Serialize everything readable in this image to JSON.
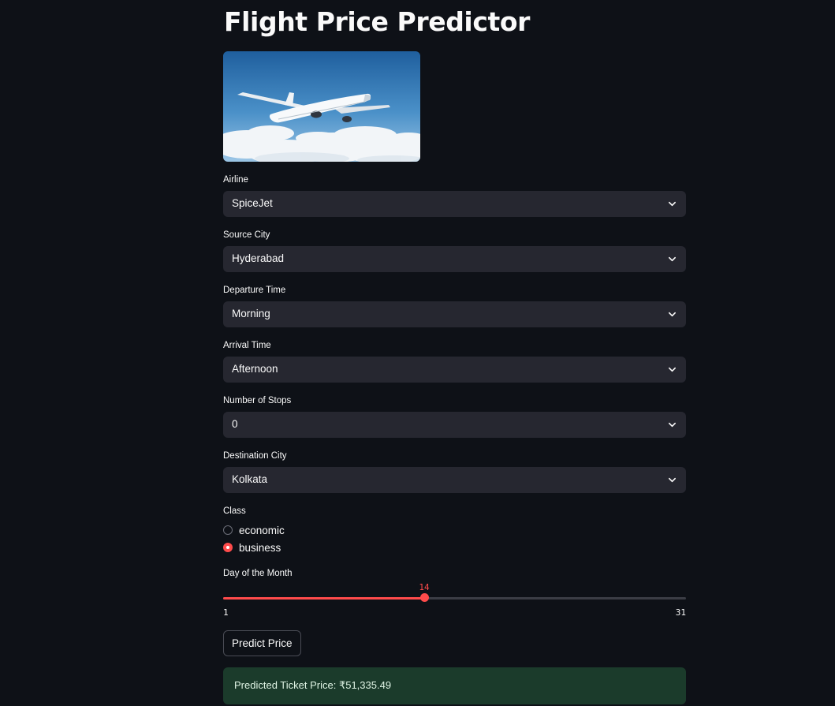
{
  "page": {
    "title": "Flight Price Predictor"
  },
  "hero_image": {
    "alt": "airplane flying above clouds"
  },
  "fields": {
    "airline": {
      "label": "Airline",
      "value": "SpiceJet"
    },
    "source_city": {
      "label": "Source City",
      "value": "Hyderabad"
    },
    "departure_time": {
      "label": "Departure Time",
      "value": "Morning"
    },
    "arrival_time": {
      "label": "Arrival Time",
      "value": "Afternoon"
    },
    "stops": {
      "label": "Number of Stops",
      "value": "0"
    },
    "destination_city": {
      "label": "Destination City",
      "value": "Kolkata"
    }
  },
  "class_radio": {
    "label": "Class",
    "options": [
      {
        "label": "economic",
        "selected": false
      },
      {
        "label": "business",
        "selected": true
      }
    ]
  },
  "day_slider": {
    "label": "Day of the Month",
    "value": 14,
    "value_label": "14",
    "min_label": "1",
    "max_label": "31",
    "min": 1,
    "max": 31
  },
  "predict_button": {
    "label": "Predict Price"
  },
  "result": {
    "text": "Predicted Ticket Price: ₹51,335.49"
  },
  "colors": {
    "background": "#0e1117",
    "accent": "#ff4b4b",
    "input_bg": "#262730",
    "success_bg": "#1b3b2b"
  },
  "icons": {
    "select_chevron": "chevron-down-icon"
  }
}
